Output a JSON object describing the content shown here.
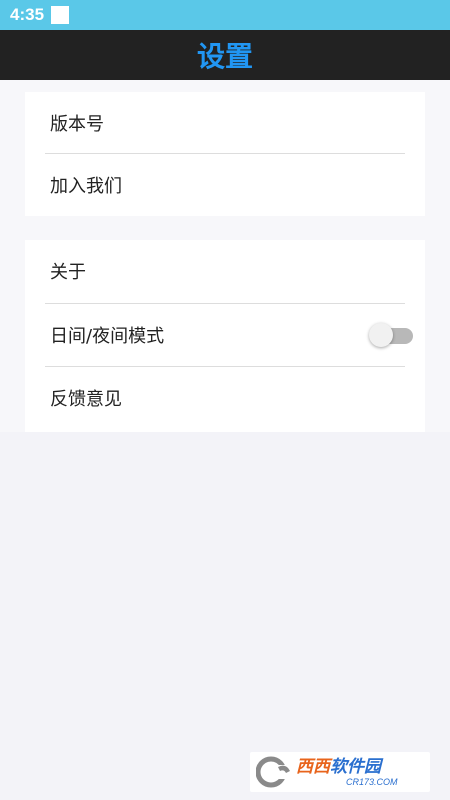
{
  "status_bar": {
    "time": "4:35"
  },
  "header": {
    "title": "设置",
    "title_color": "#2196f3"
  },
  "settings": {
    "group1": [
      {
        "label": "版本号"
      },
      {
        "label": "加入我们"
      }
    ],
    "group2": [
      {
        "label": "关于"
      },
      {
        "label": "日间/夜间模式",
        "toggle_on": false
      },
      {
        "label": "反馈意见"
      }
    ]
  },
  "watermark": {
    "cn_left": "西西",
    "cn_right": "软件园",
    "en": "CR173.COM"
  },
  "colors": {
    "status_bar": "#5ac8e8",
    "header_bg": "#222222",
    "page_bg": "#f3f3f8"
  }
}
